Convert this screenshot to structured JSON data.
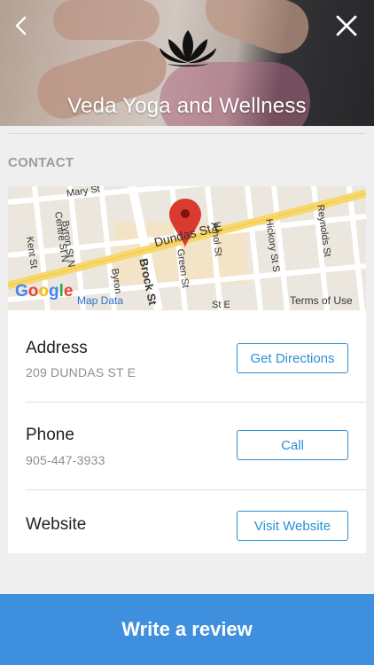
{
  "header": {
    "title": "Veda Yoga and Wellness",
    "back_icon": "chevron-left-icon",
    "close_icon": "close-icon",
    "logo": "lotus-logo"
  },
  "contact": {
    "section_label": "CONTACT",
    "map": {
      "streets": [
        "Mary St",
        "Byron St N",
        "Centre St N",
        "Kent St",
        "Brock St",
        "Byron",
        "Green St",
        "Athol St",
        "Hickory St S",
        "Reynolds St",
        "Dundas St E",
        "St E"
      ],
      "attribution": "Map Data",
      "terms": "Terms of Use",
      "brand": "Google"
    },
    "rows": [
      {
        "label": "Address",
        "value": "209 DUNDAS ST E",
        "button": "Get Directions"
      },
      {
        "label": "Phone",
        "value": "905-447-3933",
        "button": "Call"
      },
      {
        "label": "Website",
        "value": "",
        "button": "Visit Website"
      }
    ]
  },
  "footer": {
    "cta": "Write a review"
  },
  "colors": {
    "accent": "#2d8fd5",
    "cta_bg": "#3f8fdf",
    "pin": "#d93b30"
  }
}
